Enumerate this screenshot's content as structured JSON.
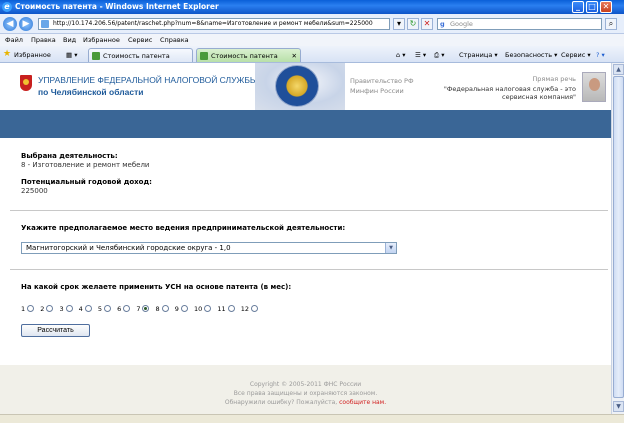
{
  "window": {
    "title": "Стоимость патента - Windows Internet Explorer"
  },
  "address": {
    "url": "http://10.174.206.56/patent/raschet.php?num=8&name=Изготовление и ремонт мебели&sum=225000",
    "search_placeholder": "Google"
  },
  "menu": [
    "Файл",
    "Правка",
    "Вид",
    "Избранное",
    "Сервис",
    "Справка"
  ],
  "tabs": {
    "favorites_label": "Избранное",
    "items": [
      {
        "label": "Стоимость патента"
      },
      {
        "label": "Стоимость патента"
      }
    ],
    "tools": [
      "Страница ▾",
      "Безопасность ▾",
      "Сервис ▾"
    ]
  },
  "header": {
    "org_line1": "УПРАВЛЕНИЕ ФЕДЕРАЛЬНОЙ НАЛОГОВОЙ СЛУЖБЫ",
    "org_line2": "по Челябинской области",
    "gov_line1": "Правительство РФ",
    "gov_line2": "Минфин России",
    "speech_title": "Прямая речь",
    "quote_line1": "\"Федеральная налоговая служба - это",
    "quote_line2": "сервисная компания\""
  },
  "form": {
    "activity_label": "Выбрана деятельность:",
    "activity_value": "8 - Изготовление и ремонт мебели",
    "income_label": "Потенциальный годовой доход:",
    "income_value": "225000",
    "place_label": "Укажите предполагаемое место ведения предпринимательской деятельности:",
    "place_selected": "Магнитогорский и Челябинский городские округа - 1,0",
    "term_label": "На какой срок желаете применить УСН на основе патента (в мес):",
    "months": [
      "1",
      "2",
      "3",
      "4",
      "5",
      "6",
      "7",
      "8",
      "9",
      "10",
      "11",
      "12"
    ],
    "selected_month": "7",
    "calc_button": "Рассчитать"
  },
  "footer": {
    "copyright": "Copyright © 2005-2011 ФНС России",
    "rights": "Все права защищены и охраняются законом.",
    "error_text": "Обнаружили ошибку? Пожалуйста,",
    "error_link": "сообщите нам."
  }
}
